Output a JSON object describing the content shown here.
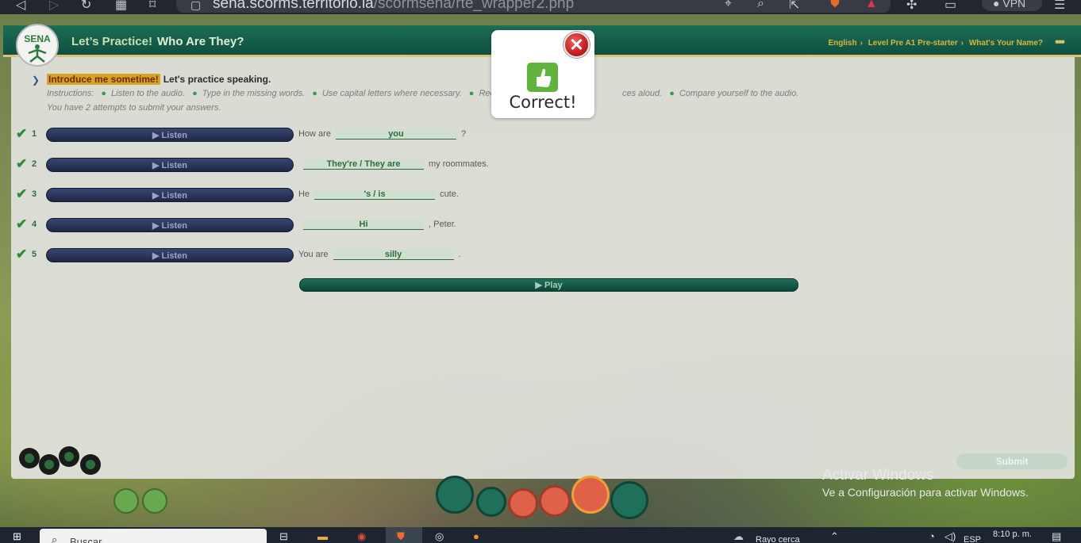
{
  "browser": {
    "url_host": "sena.scorms.territorio.la",
    "url_path": "/scormsena/rte_wrapper2.php",
    "vpn_label": "VPN"
  },
  "header": {
    "logo_text": "SENA",
    "title": "Let’s Practice!",
    "subtitle": "Who Are They?",
    "breadcrumb": [
      "English",
      "Level Pre A1 Pre-starter",
      "What's Your Name?"
    ],
    "menu_dots": "•••"
  },
  "intro": {
    "highlight": "Introduce me sometime!",
    "text": "Let's practice speaking.",
    "instructions_label": "Instructions:",
    "instructions": [
      "Listen to the audio.",
      "Type in the missing words.",
      "Use capital letters where necessary.",
      "Record",
      "ces aloud.",
      "Compare yourself to the audio."
    ],
    "attempts": "You have 2 attempts to submit your answers."
  },
  "exercises": [
    {
      "num": "1",
      "listen": "▶ Listen",
      "before": "How are",
      "answer": "you",
      "after": "?"
    },
    {
      "num": "2",
      "listen": "▶ Listen",
      "before": "",
      "answer": "They're  / They are",
      "after": "my roommates."
    },
    {
      "num": "3",
      "listen": "▶ Listen",
      "before": "He",
      "answer": "'s / is",
      "after": "cute."
    },
    {
      "num": "4",
      "listen": "▶ Listen",
      "before": "",
      "answer": "Hi",
      "after": ", Peter."
    },
    {
      "num": "5",
      "listen": "▶ Listen",
      "before": "You are",
      "answer": "silly",
      "after": "."
    }
  ],
  "play_label": "▶ Play",
  "submit_label": "Submit",
  "popup": {
    "message": "Correct!",
    "close": "✕"
  },
  "watermark": {
    "line1": "Activar Windows",
    "line2": "Ve a Configuración para activar Windows."
  },
  "taskbar": {
    "search_placeholder": "Buscar",
    "weather": "Rayo cerca",
    "lang": "ESP",
    "time": "8:10 p. m."
  },
  "colors": {
    "header_green": "#1b6e57",
    "correct_green": "#2e8c3e",
    "listen_navy": "#1e2848",
    "breadcrumb_gold": "#d9b43e",
    "popup_close_red": "#c41e1e"
  }
}
